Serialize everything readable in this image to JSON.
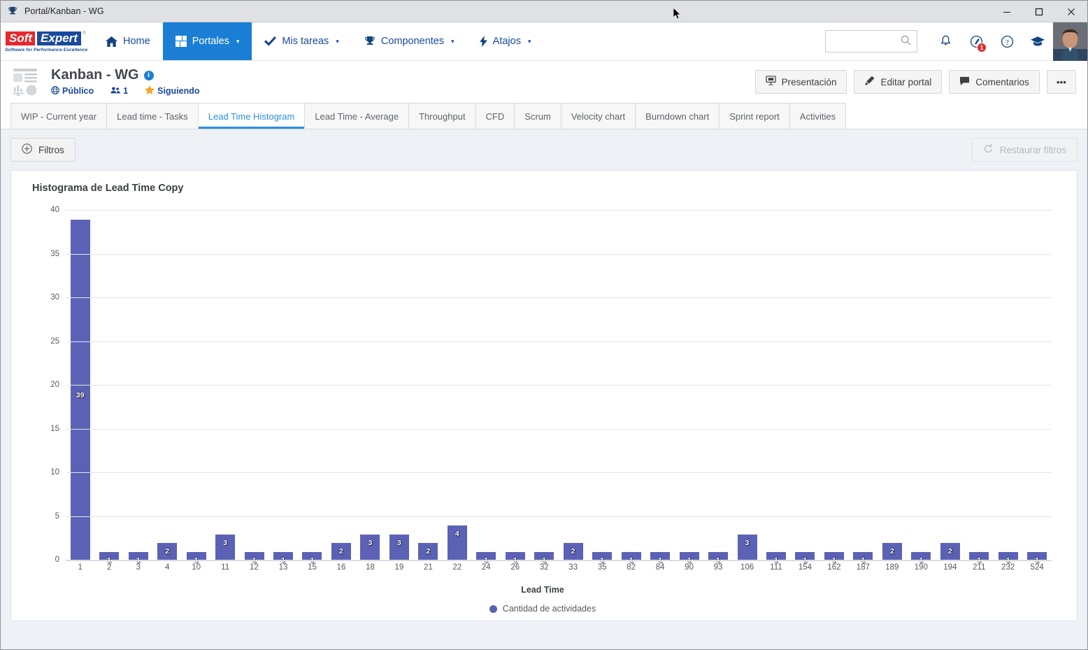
{
  "window": {
    "title": "Portal/Kanban - WG",
    "icon": "trophy-icon",
    "minimize": "—",
    "maximize": "☐",
    "close": "✕"
  },
  "brand": {
    "soft": "Soft",
    "expert": "Expert",
    "registered": "®",
    "tagline": "Software for Performance Excellence"
  },
  "nav": {
    "items": [
      {
        "label": "Home",
        "icon": "home-icon",
        "active": false,
        "caret": false
      },
      {
        "label": "Portales",
        "icon": "grid-icon",
        "active": true,
        "caret": true
      },
      {
        "label": "Mis tareas",
        "icon": "check-icon",
        "active": false,
        "caret": true
      },
      {
        "label": "Componentes",
        "icon": "trophy-icon",
        "active": false,
        "caret": true
      },
      {
        "label": "Atajos",
        "icon": "bolt-icon",
        "active": false,
        "caret": true
      }
    ],
    "caret": "▾",
    "search": {
      "value": "",
      "placeholder": ""
    },
    "icons": [
      {
        "name": "bell-icon",
        "badge": ""
      },
      {
        "name": "pen-compass-icon",
        "badge": "1"
      },
      {
        "name": "help-icon",
        "badge": ""
      },
      {
        "name": "graduation-cap-icon",
        "badge": ""
      }
    ]
  },
  "page_header": {
    "icon": "portal-icon",
    "title": "Kanban - WG",
    "info_badge": "i",
    "visibility": "Público",
    "visibility_icon": "globe-icon",
    "members_count": "1",
    "members_icon": "people-icon",
    "following": "Siguiendo",
    "following_icon": "star-icon",
    "actions": [
      {
        "label": "Presentación",
        "icon": "presentation-icon"
      },
      {
        "label": "Editar portal",
        "icon": "pencil-icon"
      },
      {
        "label": "Comentarios",
        "icon": "comment-icon"
      },
      {
        "label": "•••",
        "icon": "more-icon"
      }
    ]
  },
  "tabs": [
    {
      "label": "WIP - Current year",
      "active": false
    },
    {
      "label": "Lead time - Tasks",
      "active": false
    },
    {
      "label": "Lead Time Histogram",
      "active": true
    },
    {
      "label": "Lead Time - Average",
      "active": false
    },
    {
      "label": "Throughput",
      "active": false
    },
    {
      "label": "CFD",
      "active": false
    },
    {
      "label": "Scrum",
      "active": false
    },
    {
      "label": "Velocity chart",
      "active": false
    },
    {
      "label": "Burndown chart",
      "active": false
    },
    {
      "label": "Sprint report",
      "active": false
    },
    {
      "label": "Activities",
      "active": false
    }
  ],
  "toolbar": {
    "filters_label": "Filtros",
    "filters_icon": "plus-circle-icon",
    "restore_label": "Restaurar filtros",
    "restore_icon": "refresh-icon"
  },
  "colors": {
    "bar": "#5b62b5",
    "accent": "#1a7fd4",
    "nav_active_bg": "#1a7fd4",
    "brand_red": "#e8262d",
    "brand_blue": "#1a4a9c",
    "badge_red": "#e02a2a",
    "star_orange": "#f5a623"
  },
  "chart_data": {
    "type": "bar",
    "title": "Histograma de Lead Time Copy",
    "xlabel": "Lead Time",
    "ylabel": "",
    "ylim": [
      0,
      40
    ],
    "yticks": [
      0,
      5,
      10,
      15,
      20,
      25,
      30,
      35,
      40
    ],
    "grid": true,
    "legend": {
      "position": "bottom",
      "entries": [
        "Cantidad de actividades"
      ]
    },
    "series_name": "Cantidad de actividades",
    "categories": [
      "1",
      "2",
      "3",
      "4",
      "10",
      "11",
      "12",
      "13",
      "15",
      "16",
      "18",
      "19",
      "21",
      "22",
      "24",
      "26",
      "32",
      "33",
      "35",
      "82",
      "84",
      "90",
      "93",
      "106",
      "111",
      "154",
      "162",
      "187",
      "189",
      "190",
      "194",
      "211",
      "232",
      "524"
    ],
    "values": [
      39,
      1,
      1,
      2,
      1,
      3,
      1,
      1,
      1,
      2,
      3,
      3,
      2,
      4,
      1,
      1,
      1,
      2,
      1,
      1,
      1,
      1,
      1,
      3,
      1,
      1,
      1,
      1,
      2,
      1,
      2,
      1,
      1,
      1
    ]
  }
}
